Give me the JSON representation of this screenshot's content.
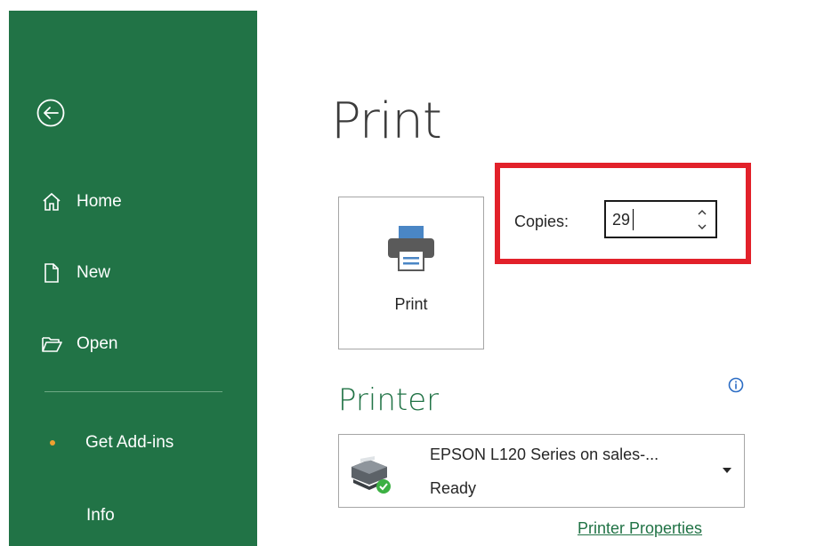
{
  "sidebar": {
    "back_icon": "back-arrow-circle-icon",
    "items": [
      {
        "label": "Home",
        "icon": "home-icon"
      },
      {
        "label": "New",
        "icon": "new-document-icon"
      },
      {
        "label": "Open",
        "icon": "open-folder-icon"
      },
      {
        "label": "Get Add-ins",
        "icon": "dot"
      },
      {
        "label": "Info",
        "icon": ""
      }
    ],
    "bg_color": "#217346"
  },
  "main": {
    "title": "Print",
    "print_button_label": "Print",
    "copies": {
      "label": "Copies:",
      "value": "29"
    },
    "highlight_color": "#e2212a",
    "printer_section": {
      "heading": "Printer",
      "selected_printer": "EPSON L120 Series on sales-...",
      "status": "Ready",
      "properties_link": "Printer Properties"
    }
  }
}
